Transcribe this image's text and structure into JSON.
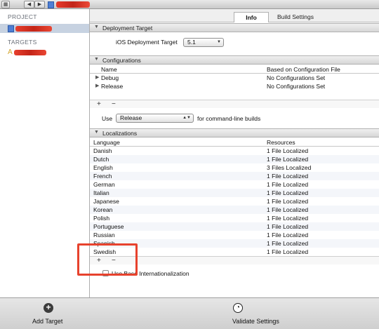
{
  "toolbar": {
    "back": "◀",
    "forward": "▶",
    "grid": "▦"
  },
  "sidebar": {
    "project_heading": "PROJECT",
    "project_item": "redacted",
    "targets_heading": "TARGETS",
    "target_item": "redacted"
  },
  "tabs": {
    "info": "Info",
    "build_settings": "Build Settings"
  },
  "deployment": {
    "section_title": "Deployment Target",
    "label": "iOS Deployment Target",
    "value": "5.1"
  },
  "configurations": {
    "section_title": "Configurations",
    "col_name": "Name",
    "col_based_on": "Based on Configuration File",
    "rows": [
      {
        "name": "Debug",
        "based_on": "No Configurations Set"
      },
      {
        "name": "Release",
        "based_on": "No Configurations Set"
      }
    ],
    "add": "+",
    "remove": "−",
    "use_label": "Use",
    "use_value": "Release",
    "use_suffix": "for command-line builds"
  },
  "localizations": {
    "section_title": "Localizations",
    "col_language": "Language",
    "col_resources": "Resources",
    "rows": [
      {
        "language": "Danish",
        "resources": "1 File Localized"
      },
      {
        "language": "Dutch",
        "resources": "1 File Localized"
      },
      {
        "language": "English",
        "resources": "3 Files Localized"
      },
      {
        "language": "French",
        "resources": "1 File Localized"
      },
      {
        "language": "German",
        "resources": "1 File Localized"
      },
      {
        "language": "Italian",
        "resources": "1 File Localized"
      },
      {
        "language": "Japanese",
        "resources": "1 File Localized"
      },
      {
        "language": "Korean",
        "resources": "1 File Localized"
      },
      {
        "language": "Polish",
        "resources": "1 File Localized"
      },
      {
        "language": "Portuguese",
        "resources": "1 File Localized"
      },
      {
        "language": "Russian",
        "resources": "1 File Localized"
      },
      {
        "language": "Spanish",
        "resources": "1 File Localized"
      },
      {
        "language": "Swedish",
        "resources": "1 File Localized"
      }
    ],
    "add": "+",
    "remove": "−",
    "base_intl_label": "Use Base Internationalization"
  },
  "bottom": {
    "add_target": "Add Target",
    "validate": "Validate Settings",
    "add_glyph": "+",
    "validate_glyph": "◔"
  },
  "colors": {
    "highlight": "#e7422d",
    "selection": "#c7d2e1"
  }
}
